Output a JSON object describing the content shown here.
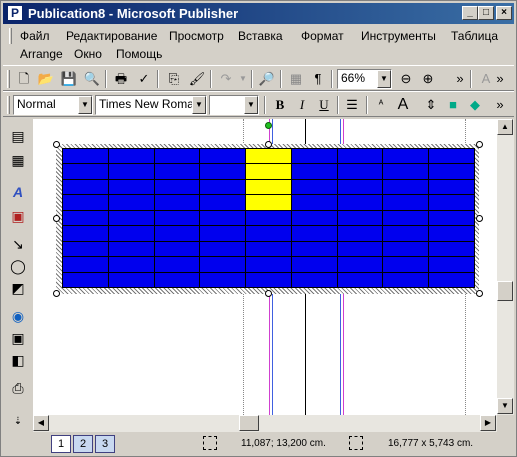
{
  "window": {
    "title": "Publication8 - Microsoft Publisher",
    "minimize_label": "_",
    "maximize_label": "□",
    "close_label": "×"
  },
  "menu": {
    "items": [
      "Файл",
      "Редактирование",
      "Просмотр",
      "Вставка",
      "Формат",
      "Инструменты",
      "Таблица",
      "Arrange",
      "Окно",
      "Помощь"
    ]
  },
  "toolbar_standard": {
    "zoom_value": "66%",
    "more_label": "»"
  },
  "toolbar_format": {
    "style_value": "Normal",
    "font_value": "Times New Roman",
    "size_value": "",
    "bold_label": "B",
    "italic_label": "I",
    "underline_label": "U"
  },
  "table": {
    "rows": 9,
    "cols": 9,
    "fill_color": "#0000ee",
    "selected_color": "#ffff00",
    "selected_column_index": 4,
    "selected_row_count": 4
  },
  "statusbar": {
    "page_tabs": [
      "1",
      "2",
      "3"
    ],
    "position_text": "11,087; 13,200 cm.",
    "size_text": "16,777 x   5,743 cm."
  }
}
